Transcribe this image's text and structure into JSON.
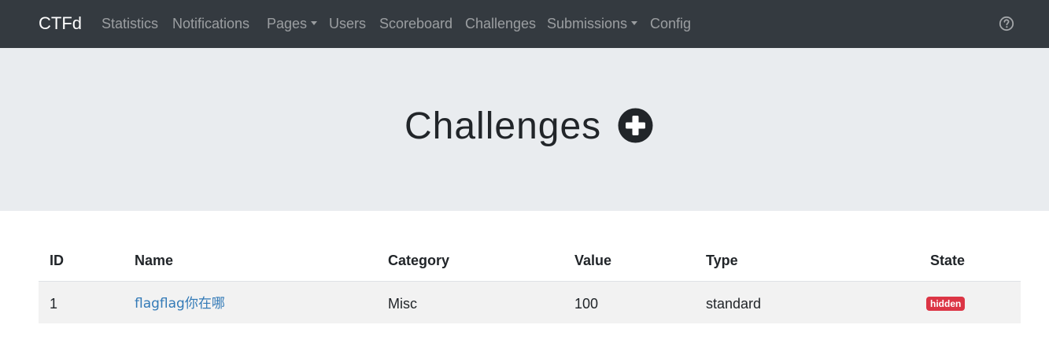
{
  "navbar": {
    "brand": "CTFd",
    "items": [
      {
        "label": "Statistics"
      },
      {
        "label": "Notifications"
      },
      {
        "label": "Pages"
      },
      {
        "label": "Users"
      },
      {
        "label": "Scoreboard"
      },
      {
        "label": "Challenges"
      },
      {
        "label": "Submissions"
      },
      {
        "label": "Config"
      }
    ],
    "help_icon": "question-circle-icon"
  },
  "header": {
    "title": "Challenges",
    "add_icon": "plus-circle-icon"
  },
  "table": {
    "columns": [
      "ID",
      "Name",
      "Category",
      "Value",
      "Type",
      "State"
    ],
    "rows": [
      {
        "id": "1",
        "name": "flagflag你在哪",
        "category": "Misc",
        "value": "100",
        "type": "standard",
        "state": "hidden"
      }
    ]
  },
  "colors": {
    "navbar_bg": "#343a40",
    "jumbotron_bg": "#e9ecef",
    "link": "#337ab7",
    "badge_hidden": "#dc3545"
  }
}
